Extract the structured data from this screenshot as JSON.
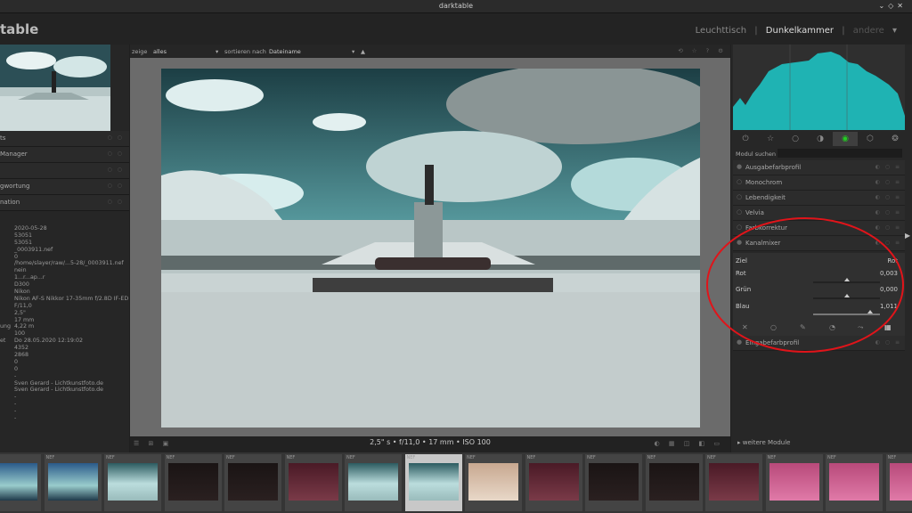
{
  "window": {
    "title": "darktable"
  },
  "header": {
    "app_title": "table",
    "views": [
      "Leuchttisch",
      "Dunkelkammer",
      "andere"
    ],
    "sep": "|"
  },
  "left_panel": {
    "sections": [
      {
        "label": "ts"
      },
      {
        "label": "Manager"
      },
      {
        "label": ""
      },
      {
        "label": "gwortung"
      },
      {
        "label": "nation"
      }
    ],
    "info": [
      {
        "k": "",
        "v": "2020-05-28"
      },
      {
        "k": "",
        "v": "53051"
      },
      {
        "k": "",
        "v": "53051"
      },
      {
        "k": "",
        "v": "_0003911.nef"
      },
      {
        "k": "",
        "v": "0"
      },
      {
        "k": "",
        "v": "/home/slayer/raw/...5-28/_0003911.nef"
      },
      {
        "k": "",
        "v": "nein"
      },
      {
        "k": "",
        "v": "1...r...ap...r"
      },
      {
        "k": "",
        "v": "D300"
      },
      {
        "k": "",
        "v": "Nikon"
      },
      {
        "k": "",
        "v": "Nikon AF-S Nikkor 17-35mm f/2.8D IF-ED"
      },
      {
        "k": "",
        "v": "F/11,0"
      },
      {
        "k": "",
        "v": "2,5\""
      },
      {
        "k": "",
        "v": "17 mm"
      },
      {
        "k": "ung",
        "v": "4,22 m"
      },
      {
        "k": "",
        "v": "100"
      },
      {
        "k": "et",
        "v": "Do 28.05.2020 12:19:02"
      },
      {
        "k": "",
        "v": "4352"
      },
      {
        "k": "",
        "v": "2868"
      },
      {
        "k": "",
        "v": "0"
      },
      {
        "k": "",
        "v": "0"
      },
      {
        "k": "",
        "v": "-"
      },
      {
        "k": "",
        "v": "Sven Gerard - Lichtkunstfoto.de"
      },
      {
        "k": "",
        "v": "Sven Gerard - Lichtkunstfoto.de"
      },
      {
        "k": "",
        "v": "-"
      },
      {
        "k": "",
        "v": "-"
      },
      {
        "k": "",
        "v": "-"
      },
      {
        "k": "",
        "v": "-"
      }
    ]
  },
  "topbar": {
    "show_label": "zeige",
    "show_value": "alles",
    "sort_label": "sortieren nach",
    "sort_value": "Dateiname",
    "sort_dir": "▲"
  },
  "status": {
    "exif": "2,5\" s • f/11,0 • 17 mm • ISO 100"
  },
  "right_panel": {
    "search_label": "Modul suchen",
    "modules": [
      {
        "name": "Ausgabefarbprofil"
      },
      {
        "name": "Monochrom"
      },
      {
        "name": "Lebendigkeit"
      },
      {
        "name": "Velvia"
      },
      {
        "name": "Farbkorrektur"
      },
      {
        "name": "Kanalmixer"
      },
      {
        "name": "Eingabefarbprofil"
      }
    ],
    "mixer": {
      "target_label": "Ziel",
      "target_value": "Rot",
      "rows": [
        {
          "label": "Rot",
          "value": "0,003",
          "fraction": 0.5
        },
        {
          "label": "Grün",
          "value": "0,000",
          "fraction": 0.5
        },
        {
          "label": "Blau",
          "value": "1,011",
          "fraction": 0.85
        }
      ]
    },
    "more_modules": "weitere Module"
  },
  "filmstrip": {
    "label": "NEF",
    "thumbs": [
      {
        "style": "blue"
      },
      {
        "style": "blue"
      },
      {
        "style": "cyan"
      },
      {
        "style": "dark"
      },
      {
        "style": "dark"
      },
      {
        "style": "red"
      },
      {
        "style": "cyan"
      },
      {
        "style": "cyan",
        "selected": true
      },
      {
        "style": "sepia"
      },
      {
        "style": "red"
      },
      {
        "style": "dark"
      },
      {
        "style": "dark"
      },
      {
        "style": "red"
      },
      {
        "style": "pink"
      },
      {
        "style": "pink"
      },
      {
        "style": "pink"
      }
    ]
  },
  "colors": {
    "accent_ring": "#e0141a",
    "histogram": "#1fb3b3"
  }
}
